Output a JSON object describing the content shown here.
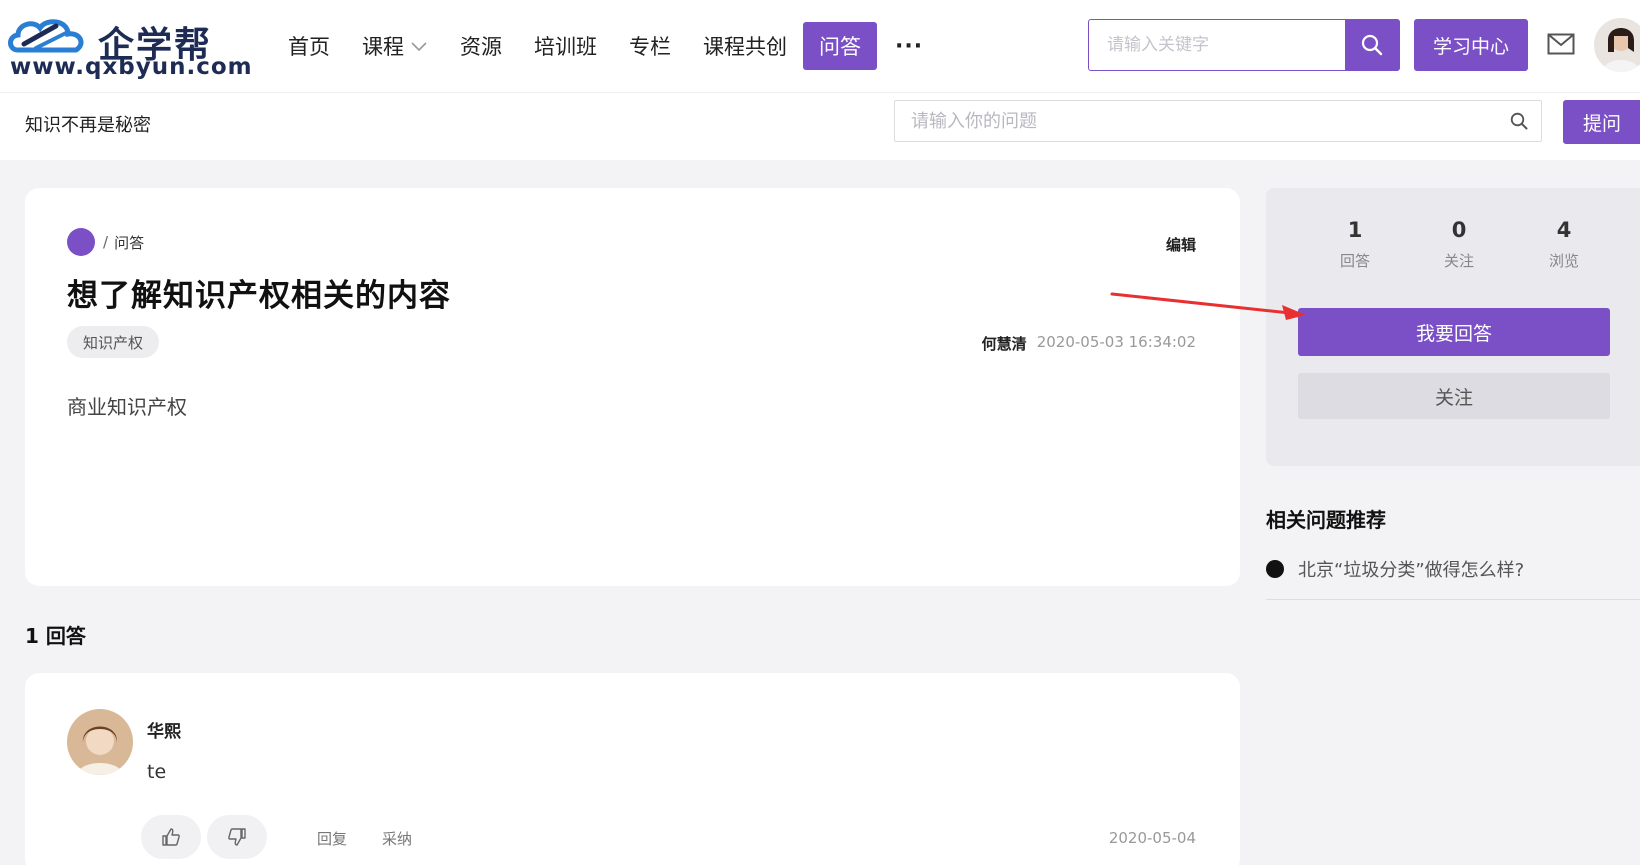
{
  "header": {
    "logo": {
      "brand": "企学帮",
      "url": "www.qxbyun.com"
    },
    "nav": [
      {
        "label": "首页",
        "active": false,
        "dropdown": false
      },
      {
        "label": "课程",
        "active": false,
        "dropdown": true
      },
      {
        "label": "资源",
        "active": false,
        "dropdown": false
      },
      {
        "label": "培训班",
        "active": false,
        "dropdown": false
      },
      {
        "label": "专栏",
        "active": false,
        "dropdown": false
      },
      {
        "label": "课程共创",
        "active": false,
        "dropdown": false
      },
      {
        "label": "问答",
        "active": true,
        "dropdown": false
      }
    ],
    "more_label": "···",
    "search": {
      "placeholder": "请输入关键字",
      "value": ""
    },
    "learn_center_label": "学习中心"
  },
  "subbar": {
    "slogan": "知识不再是秘密",
    "question_search": {
      "placeholder": "请输入你的问题",
      "value": ""
    },
    "ask_label": "提问"
  },
  "question": {
    "breadcrumb": "问答",
    "edit_label": "编辑",
    "title": "想了解知识产权相关的内容",
    "tag": "知识产权",
    "author": "何慧清",
    "time": "2020-05-03 16:34:02",
    "body": "商业知识产权"
  },
  "answers": {
    "count_label": "1 回答",
    "items": [
      {
        "name": "华熙",
        "text": "te",
        "reply_label": "回复",
        "accept_label": "采纳",
        "date": "2020-05-04"
      }
    ]
  },
  "sidebar": {
    "stats": [
      {
        "num": "1",
        "label": "回答"
      },
      {
        "num": "0",
        "label": "关注"
      },
      {
        "num": "4",
        "label": "浏览"
      }
    ],
    "answer_button": "我要回答",
    "follow_button": "关注",
    "related_title": "相关问题推荐",
    "related": [
      {
        "text": "北京“垃圾分类”做得怎么样?"
      }
    ]
  },
  "colors": {
    "accent": "#7b4fc6",
    "arrow": "#e83030"
  },
  "icons": [
    "cloud-logo-icon",
    "chevron-down-icon",
    "search-icon",
    "mail-icon",
    "avatar",
    "thumb-up-icon",
    "thumb-down-icon",
    "annotation-arrow"
  ]
}
